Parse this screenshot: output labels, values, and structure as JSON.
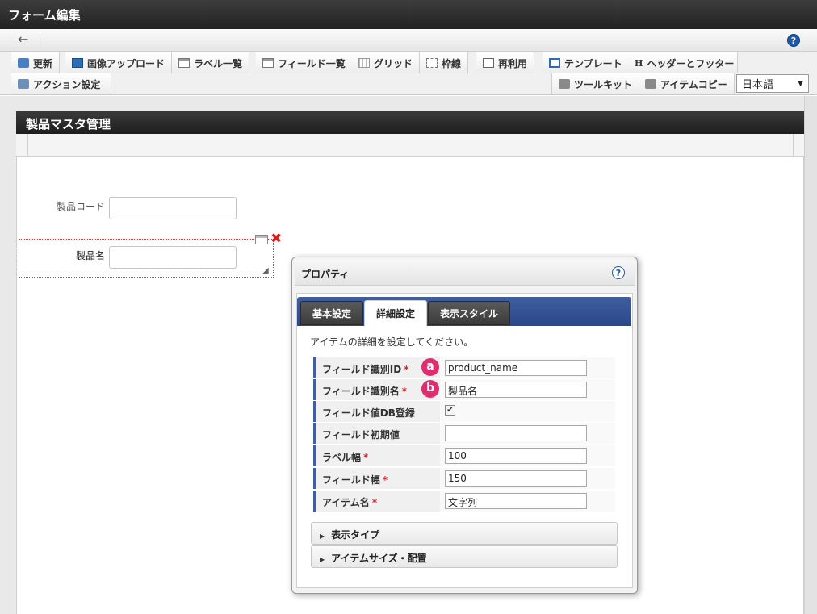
{
  "window": {
    "title": "フォーム編集"
  },
  "nav": {
    "back_icon": "←",
    "help_icon": "?"
  },
  "toolbar": {
    "row1": [
      {
        "label": "更新",
        "icon": "refresh-icon"
      },
      {
        "label": "画像アップロード",
        "icon": "image-upload-icon"
      },
      {
        "label": "ラベル一覧",
        "icon": "label-list-icon"
      },
      {
        "label": "フィールド一覧",
        "icon": "field-list-icon"
      },
      {
        "label": "グリッド",
        "icon": "grid-icon"
      },
      {
        "label": "枠線",
        "icon": "border-icon"
      },
      {
        "label": "再利用",
        "icon": "reuse-icon"
      },
      {
        "label": "テンプレート",
        "icon": "template-icon"
      },
      {
        "label": "ヘッダーとフッター",
        "icon": "header-footer-icon"
      }
    ],
    "action_settings": "アクション設定",
    "toolkit": "ツールキット",
    "item_copy": "アイテムコピー",
    "language": "日本語",
    "h_glyph": "H"
  },
  "form": {
    "title": "製品マスタ管理",
    "fields": [
      {
        "label": "製品コード",
        "value": ""
      },
      {
        "label": "製品名",
        "value": ""
      }
    ]
  },
  "property_dialog": {
    "title": "プロパティ",
    "help_icon": "?",
    "tabs": [
      "基本設定",
      "詳細設定",
      "表示スタイル"
    ],
    "active_tab": "詳細設定",
    "description": "アイテムの詳細を設定してください。",
    "rows": [
      {
        "label": "フィールド識別ID",
        "required": "*",
        "value": "product_name",
        "badge": "a"
      },
      {
        "label": "フィールド識別名",
        "required": "*",
        "value": "製品名",
        "badge": "b"
      },
      {
        "label": "フィールド値DB登録",
        "required": "",
        "checked": "✔"
      },
      {
        "label": "フィールド初期値",
        "required": "",
        "value": ""
      },
      {
        "label": "ラベル幅",
        "required": "*",
        "value": "100"
      },
      {
        "label": "フィールド幅",
        "required": "*",
        "value": "150"
      },
      {
        "label": "アイテム名",
        "required": "*",
        "value": "文字列"
      }
    ],
    "sections": [
      "表示タイプ",
      "アイテムサイズ・配置"
    ]
  },
  "colors": {
    "accent": "#3f5fa0",
    "badge": "#e02d6f",
    "required": "#dd2222",
    "close": "#d62020"
  }
}
